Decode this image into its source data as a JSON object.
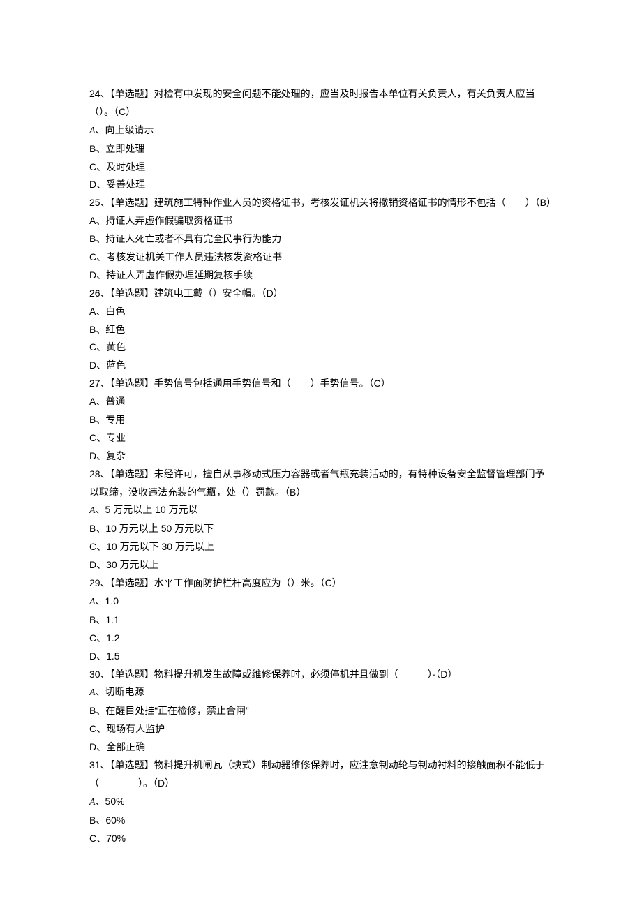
{
  "lines": [
    "24、【单选题】对检有中发现的安全问题不能处理的，应当及时报告本单位有关负责人，有关负责人应当（）。（C）",
    "A、向上级请示",
    "B、立即处理",
    "C、及时处理",
    "D、妥善处理",
    "25、【单选题】建筑施工特种作业人员的资格证书，考核发证机关将撤销资格证书的情形不包括（　　）（B）",
    "A、持证人弄虚作假骗取资格证书",
    "B、持证人死亡或者不具有完全民事行为能力",
    "C、考核发证机关工作人员违法核发资格证书",
    "D、持证人弄虚作假办理延期复核手续",
    "26、【单选题】建筑电工戴（）安全帽。（D）",
    "A、白色",
    "B、红色",
    "C、黄色",
    "D、蓝色",
    "27、【单选题】手势信号包括通用手势信号和（　　）手势信号。（C）",
    "A、普通",
    "B、专用",
    "C、专业",
    "D、复杂",
    "28、【单选题】未经许可，擅自从事移动式压力容器或者气瓶充装活动的，有特种设备安全监督管理部门予以取缔，没收违法充装的气瓶，处（）罚款。（B）",
    "A、5 万元以上 10 万元以",
    "B、10 万元以上 50 万元以下",
    "C、10 万元以下 30 万元以上",
    "D、30 万元以上",
    "29、【单选题】水平工作面防护栏杆高度应为（）米。（C）",
    "A、1.0",
    "B、1.1",
    "C、1.2",
    "D、1.5",
    "30、【单选题】物料提升机发生故障或维修保养时，必须停机并且做到（　　　）·（D）",
    "A、切断电源",
    "B、在醒目处挂“正在检修，禁止合闸”",
    "C、现场有人监护",
    "D、全部正确",
    "31、【单选题】物料提升机闸瓦（块式）制动器维修保养时，应注意制动轮与制动衬料的接触面积不能低于（　　　　）。（D）",
    "A、50%",
    "B、60%",
    "C、70%"
  ],
  "italicA": "A"
}
